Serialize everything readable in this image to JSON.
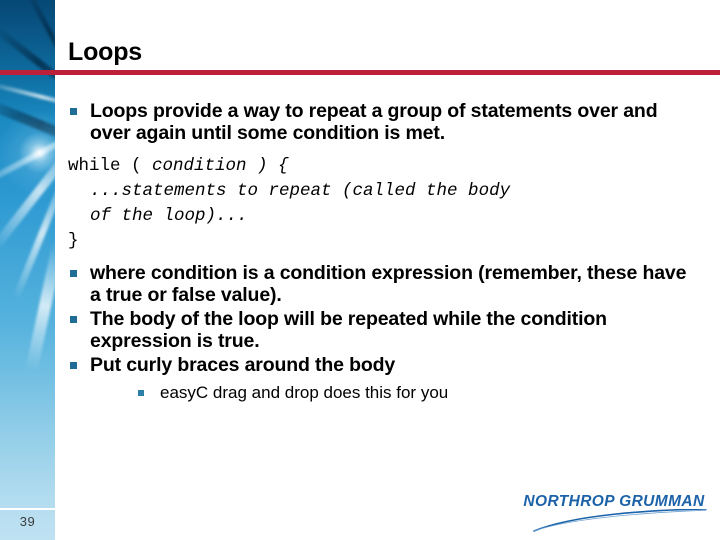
{
  "slide": {
    "title": "Loops",
    "page_number": "39",
    "accent_rule_color": "#bd2139",
    "bullet_marker_color": "#1f6c96",
    "sidebar_blue": "#1484bb",
    "logo_color": "#1c62a8"
  },
  "content": {
    "bullets": [
      "Loops provide a way to repeat a group of statements over and over again until some condition is met.",
      "where condition is a condition expression (remember, these have a true or false value).",
      "The body of the loop will be repeated while the condition expression is true.",
      "Put curly braces around the body"
    ],
    "sub_bullets": [
      "easyC drag and drop does this for you"
    ],
    "code": {
      "line1_plain": "while ( ",
      "line1_italic": "condition ) {",
      "line2_italic": "...statements to repeat (called the body",
      "line3_italic": "of the loop)...",
      "line4_plain": "}"
    }
  },
  "logo": {
    "name": "NORTHROP GRUMMAN"
  }
}
